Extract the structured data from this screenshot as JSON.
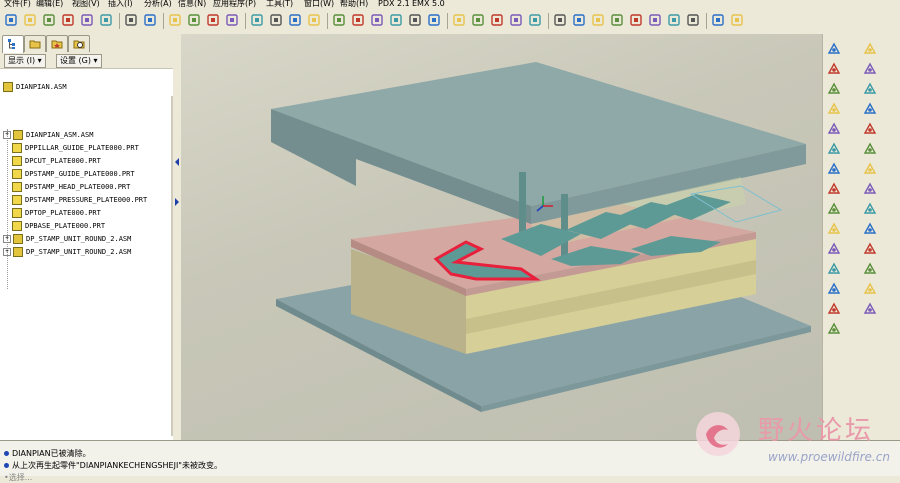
{
  "menu": [
    "文件(F)",
    "编辑(E)",
    "视图(V)",
    "插入(I)",
    "分析(A)",
    "信息(N)",
    "应用程序(P)",
    "工具(T)",
    "窗口(W)",
    "帮助(H)",
    "PDX 2.1",
    "EMX 5.0"
  ],
  "toolbar": {
    "icons": [
      "new-icon",
      "open-icon",
      "open-folder-icon",
      "save-icon",
      "print-icon",
      "email-icon",
      "undo-icon",
      "redo-icon",
      "cut-icon",
      "copy-icon",
      "paste-icon",
      "paste-special-icon",
      "regenerate-icon",
      "regen-manager-icon",
      "find-icon",
      "select-box-icon",
      "datum-display-icon",
      "spin-center-icon",
      "orient-icon",
      "saved-views-icon",
      "layers-icon",
      "repaint-icon",
      "zoom-in-icon",
      "zoom-out-icon",
      "refit-icon",
      "reorient-icon",
      "view-manager-icon",
      "wireframe-icon",
      "hidden-line-icon",
      "no-hidden-icon",
      "shading-icon",
      "plane-display-icon",
      "axis-display-icon",
      "point-display-icon",
      "csys-display-icon",
      "close-window-icon",
      "context-help-icon"
    ]
  },
  "model_tree": {
    "tabs": [
      "model-tree-tab",
      "folder-browser-tab",
      "favorites-tab",
      "history-tab"
    ],
    "show_button": "显示 (I) ▾",
    "settings_button": "设置 (G) ▾",
    "root": "DIANPIAN.ASM",
    "items": [
      {
        "label": "DIANPIAN_ASM.ASM",
        "type": "asm",
        "expandable": true
      },
      {
        "label": "DPPILLAR_GUIDE_PLATE000.PRT",
        "type": "prt",
        "expandable": false
      },
      {
        "label": "DPCUT_PLATE000.PRT",
        "type": "prt",
        "expandable": false
      },
      {
        "label": "DPSTAMP_GUIDE_PLATE000.PRT",
        "type": "prt",
        "expandable": false
      },
      {
        "label": "DPSTAMP_HEAD_PLATE000.PRT",
        "type": "prt",
        "expandable": false
      },
      {
        "label": "DPSTAMP_PRESSURE_PLATE000.PRT",
        "type": "prt",
        "expandable": false
      },
      {
        "label": "DPTOP_PLATE000.PRT",
        "type": "prt",
        "expandable": false
      },
      {
        "label": "DPBASE_PLATE000.PRT",
        "type": "prt",
        "expandable": false
      },
      {
        "label": "DP_STAMP_UNIT_ROUND_2.ASM",
        "type": "asm",
        "expandable": true
      },
      {
        "label": "DP_STAMP_UNIT_ROUND_2.ASM",
        "type": "asm",
        "expandable": true
      }
    ]
  },
  "messages": [
    "DIANPIAN已被清除。",
    "从上次再生起零件\"DIANPIANKECHENGSHEJI\"未被改变。",
    "•选择..."
  ],
  "right_toolbar": {
    "icons": [
      "component-place-icon",
      "create-component-icon",
      "mirror-icon",
      "plane-tool-icon",
      "axis-tool-icon",
      "point-tool-icon",
      "csys-tool-icon",
      "sketch-tool-icon",
      "curve-tool-icon",
      "extrude-icon",
      "revolve-icon",
      "sweep-icon",
      "hole-icon",
      "round-icon",
      "chamfer-icon",
      "draft-icon",
      "shell-icon",
      "rib-icon",
      "pattern-icon",
      "copy-feature-icon",
      "merge-icon",
      "trim-icon",
      "offset-icon",
      "thicken-icon",
      "solidify-icon",
      "intersect-icon",
      "extend-icon",
      "project-icon",
      "wrap-icon"
    ]
  },
  "watermark": {
    "text": "野火论坛",
    "url": "www.proewildfire.cn"
  },
  "colors": {
    "top_plate": "#8fa8a8",
    "base_plate": "#8aa3a6",
    "strip": "#d4a8a0",
    "die_plate": "#d6cf98",
    "selection": "#e8203c",
    "punch": "#5f8e8a"
  }
}
